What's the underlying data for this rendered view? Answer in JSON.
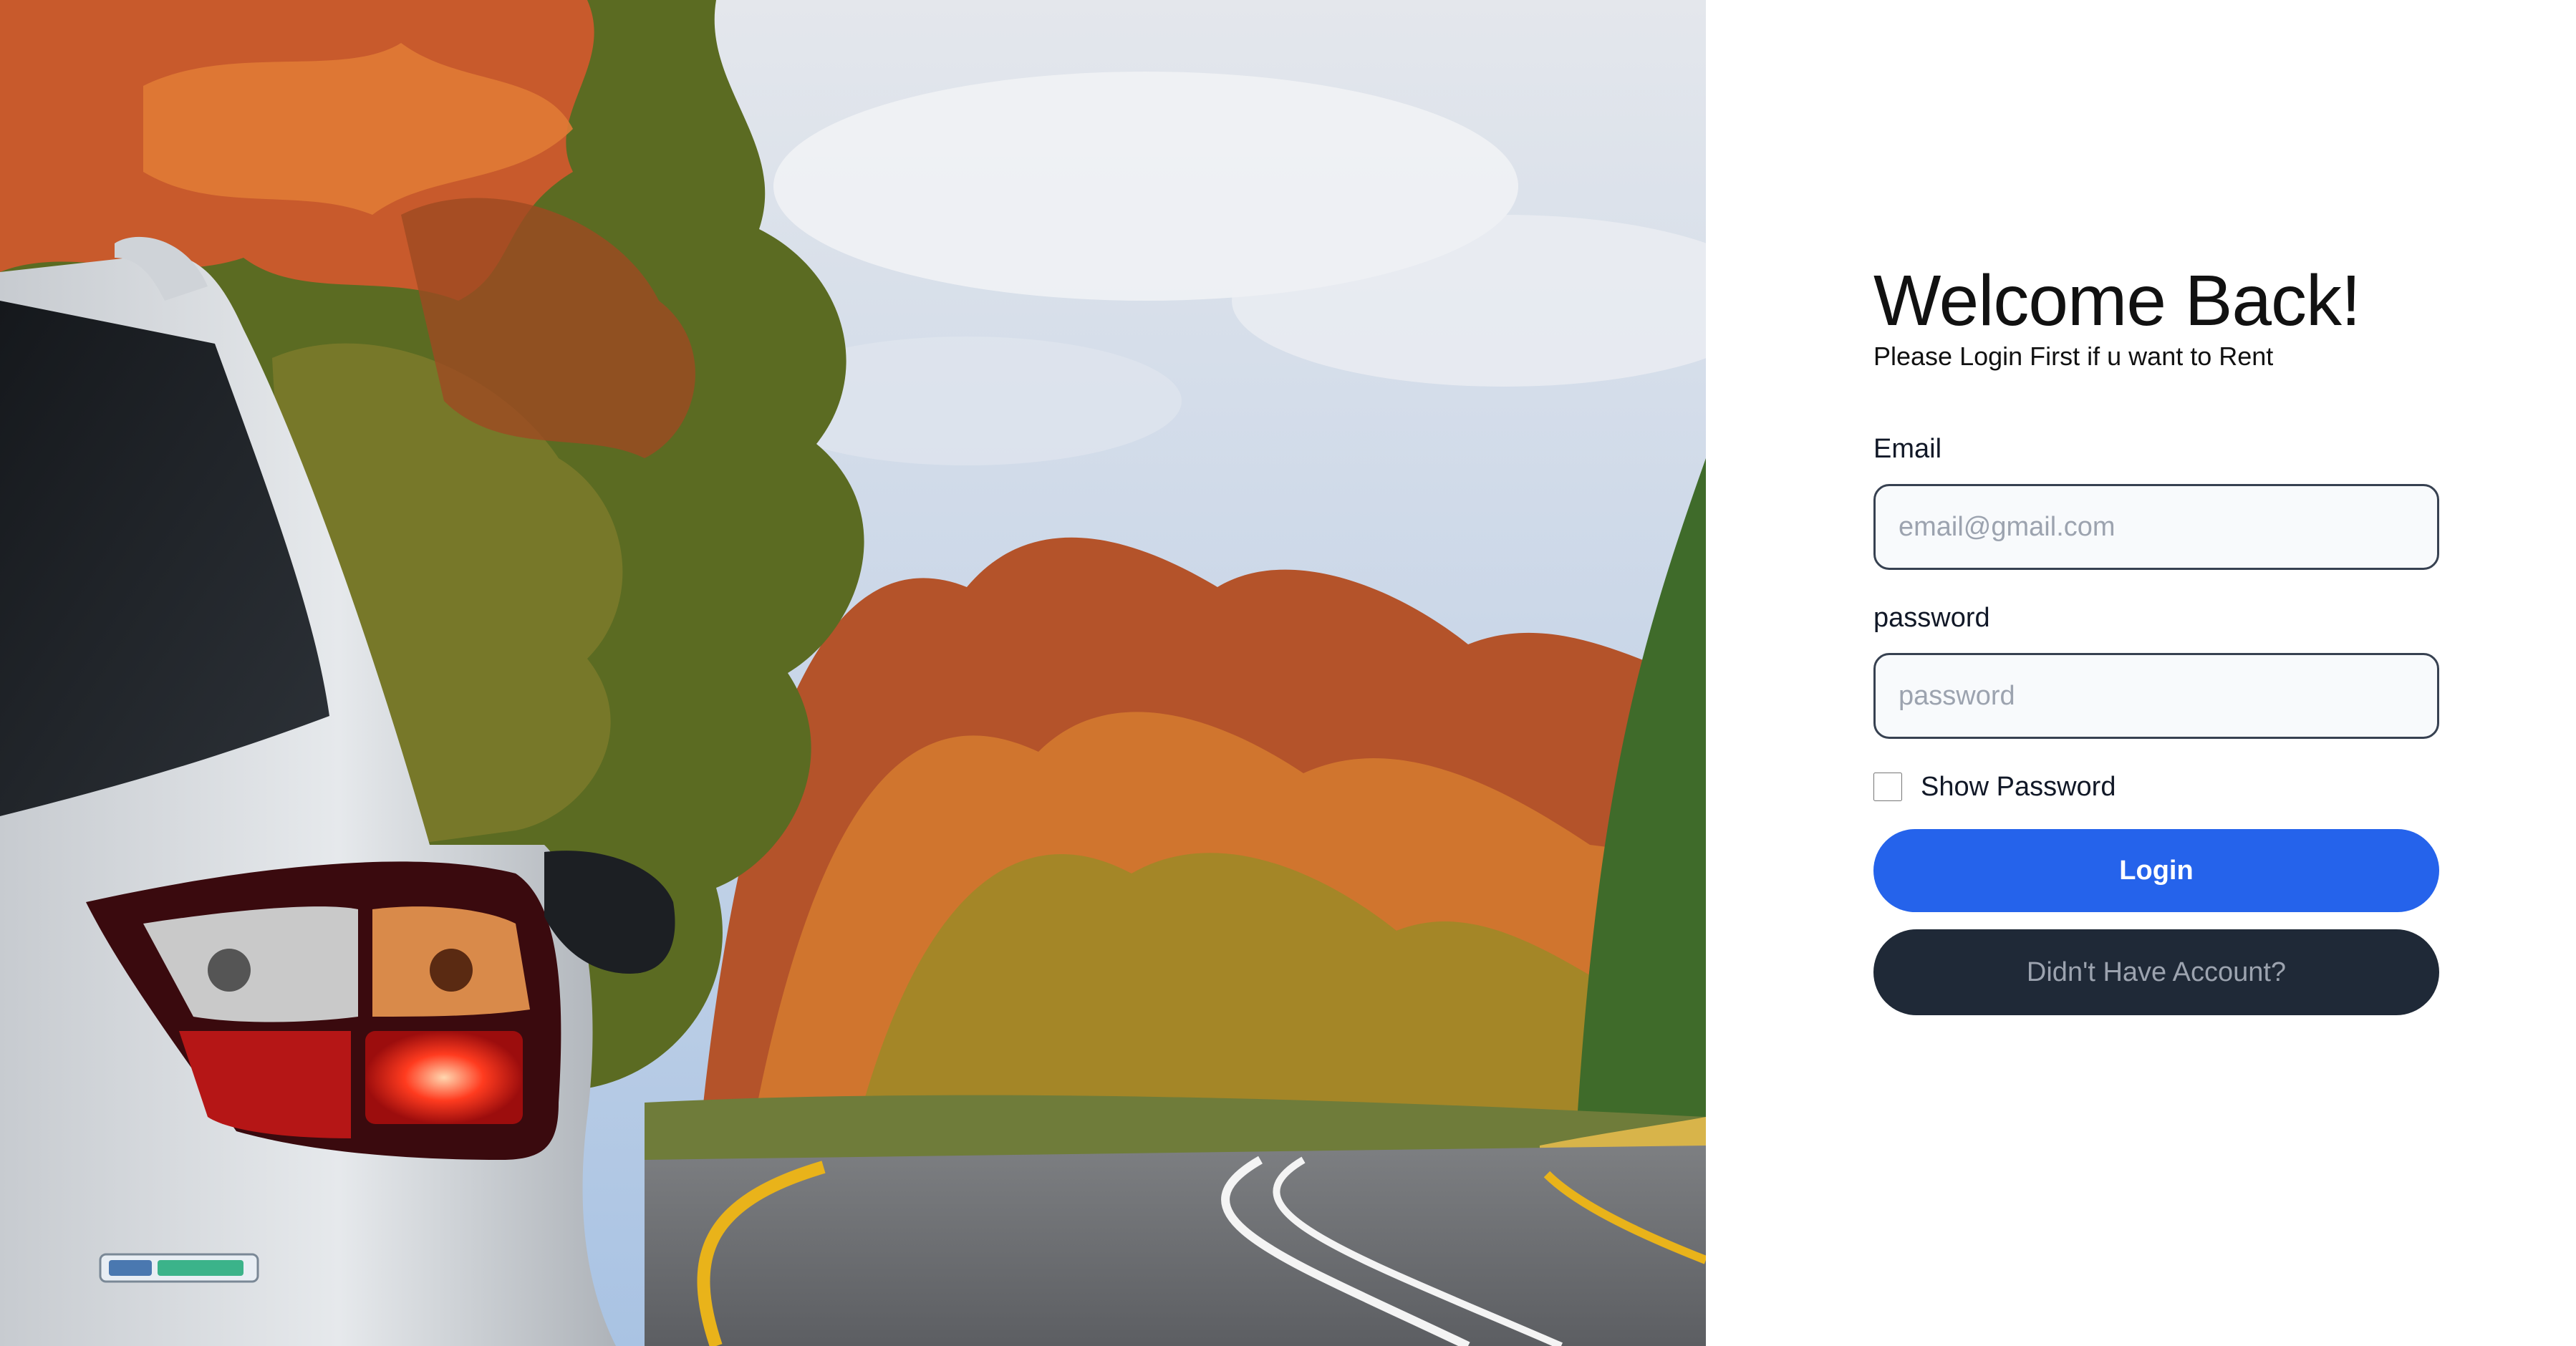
{
  "hero": {
    "icon": "car-photo-icon",
    "badge_icon": "ecosport-badge-icon"
  },
  "login": {
    "title": "Welcome Back!",
    "subtitle": "Please Login First if u want to Rent",
    "email_label": "Email",
    "email_placeholder": "email@gmail.com",
    "email_value": "",
    "password_label": "password",
    "password_placeholder": "password",
    "password_value": "",
    "show_password_label": "Show Password",
    "show_password_checked": false,
    "login_button": "Login",
    "signup_button": "Didn't Have Account?"
  },
  "colors": {
    "primary": "#2563eb",
    "dark": "#1f2937",
    "input_bg": "#f8fafc",
    "input_border": "#374151"
  }
}
